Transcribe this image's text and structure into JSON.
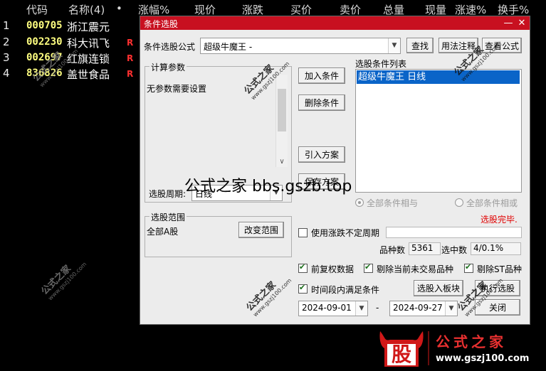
{
  "columns": [
    "代码",
    "名称(4)",
    "•",
    "涨幅%",
    "现价",
    "涨跌",
    "买价",
    "卖价",
    "总量",
    "现量",
    "涨速%",
    "换手%"
  ],
  "stocks": [
    {
      "idx": "1",
      "code": "000705",
      "name": "浙江震元",
      "flag": ""
    },
    {
      "idx": "2",
      "code": "002230",
      "name": "科大讯飞",
      "flag": "R"
    },
    {
      "idx": "3",
      "code": "002697",
      "name": "红旗连锁",
      "flag": "R"
    },
    {
      "idx": "4",
      "code": "836826",
      "name": "盖世食品",
      "flag": "R"
    }
  ],
  "dialog": {
    "title": "条件选股",
    "minimize": "—",
    "close": "✕",
    "formula_label": "条件选股公式",
    "formula_value": "超级牛魔王  -",
    "find": "查找",
    "usage": "用法注释",
    "view_formula": "查看公式",
    "params_title": "计算参数",
    "params_text": "无参数需要设置",
    "add_condition": "加入条件",
    "delete_condition": "删除条件",
    "import_plan": "引入方案",
    "save_plan": "保存方案",
    "cond_list_title": "选股条件列表",
    "cond_items": [
      "超级牛魔王  日线"
    ],
    "period_label": "选股周期:",
    "period_value": "日线",
    "radio_and": "全部条件相与",
    "radio_or": "全部条件相或",
    "status": "选股完毕.",
    "range_title": "选股范围",
    "range_value": "全部A股",
    "change_range": "改变范围",
    "use_rise_fall": "使用涨跌不定周期",
    "count_label": "品种数",
    "count_value": "5361",
    "selected_label": "选中数",
    "selected_value": "4/0.1%",
    "pre_adjust": "前复权数据",
    "exclude_untraded": "剔除当前未交易品种",
    "exclude_st": "剔除ST品种",
    "time_range": "时间段内满足条件",
    "to_block": "选股入板块",
    "execute": "执行选股",
    "date_from": "2024-09-01",
    "date_sep": "-",
    "date_to": "2024-09-27",
    "close_btn": "关闭"
  },
  "overlay_text": "公式之家 bbs.gszb.top",
  "watermark_text": "公式之家",
  "watermark_url": "www.gszj100.com",
  "logo": {
    "char": "股",
    "text": "公式之家",
    "url": "www.gszj100.com"
  },
  "colors": {
    "title_bar": "#c81020",
    "selection": "#0a64c8",
    "status": "#e00000",
    "code": "#ffff80"
  }
}
